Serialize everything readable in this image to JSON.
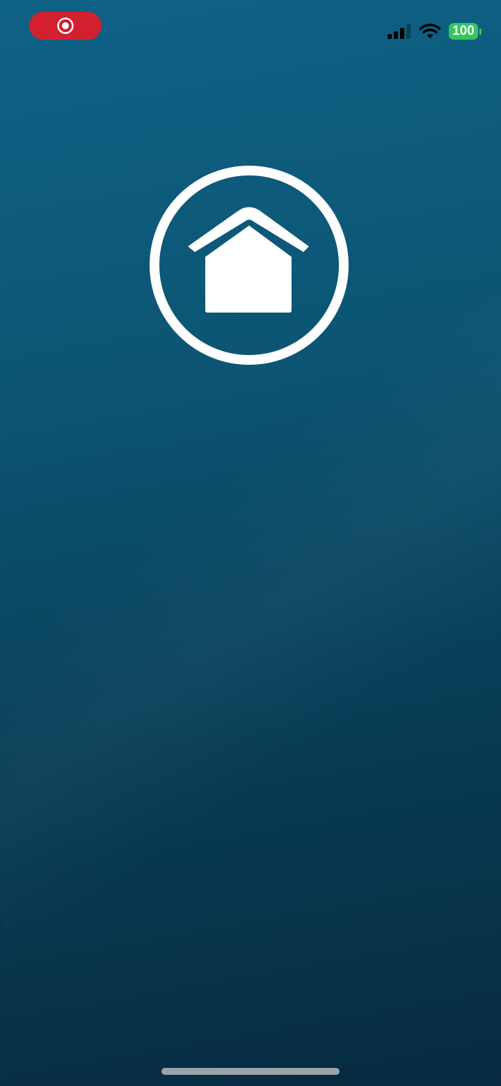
{
  "status_bar": {
    "recording_icon": "screen-recording-icon",
    "recording_color": "#d2202f",
    "signal_icon": "cellular-signal-icon",
    "wifi_icon": "wifi-icon",
    "battery_level": "100",
    "battery_color": "#34c759"
  },
  "splash": {
    "logo_icon": "home-icon",
    "background_top": "#0f6186",
    "background_bottom": "#072a40"
  },
  "home_indicator": {
    "icon": "home-indicator-bar"
  }
}
